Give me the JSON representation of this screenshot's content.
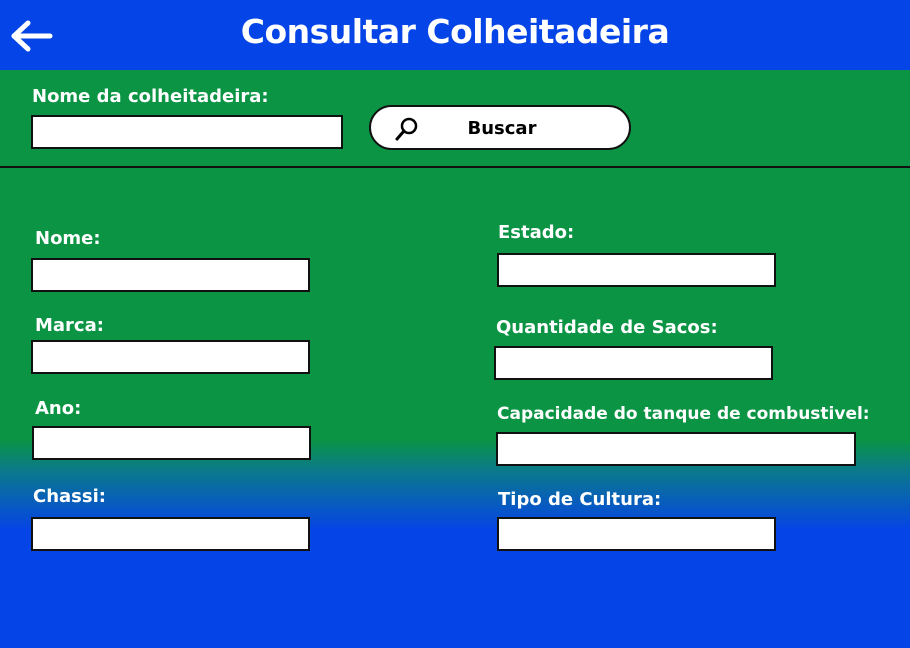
{
  "header": {
    "title": "Consultar Colheitadeira",
    "back_icon": "arrow-left-icon"
  },
  "search": {
    "label": "Nome da colheitadeira:",
    "value": "",
    "button_label": "Buscar",
    "button_icon": "magnifier-icon"
  },
  "form": {
    "left": [
      {
        "label": "Nome:",
        "value": ""
      },
      {
        "label": "Marca:",
        "value": ""
      },
      {
        "label": "Ano:",
        "value": ""
      },
      {
        "label": "Chassi:",
        "value": ""
      }
    ],
    "right": [
      {
        "label": "Estado:",
        "value": ""
      },
      {
        "label": "Quantidade de Sacos:",
        "value": ""
      },
      {
        "label": "Capacidade do tanque de combustivel:",
        "value": ""
      },
      {
        "label": "Tipo de Cultura:",
        "value": ""
      }
    ]
  },
  "colors": {
    "header_blue": "#0544e6",
    "field_green": "#0a9444",
    "text_white": "#ffffff"
  }
}
